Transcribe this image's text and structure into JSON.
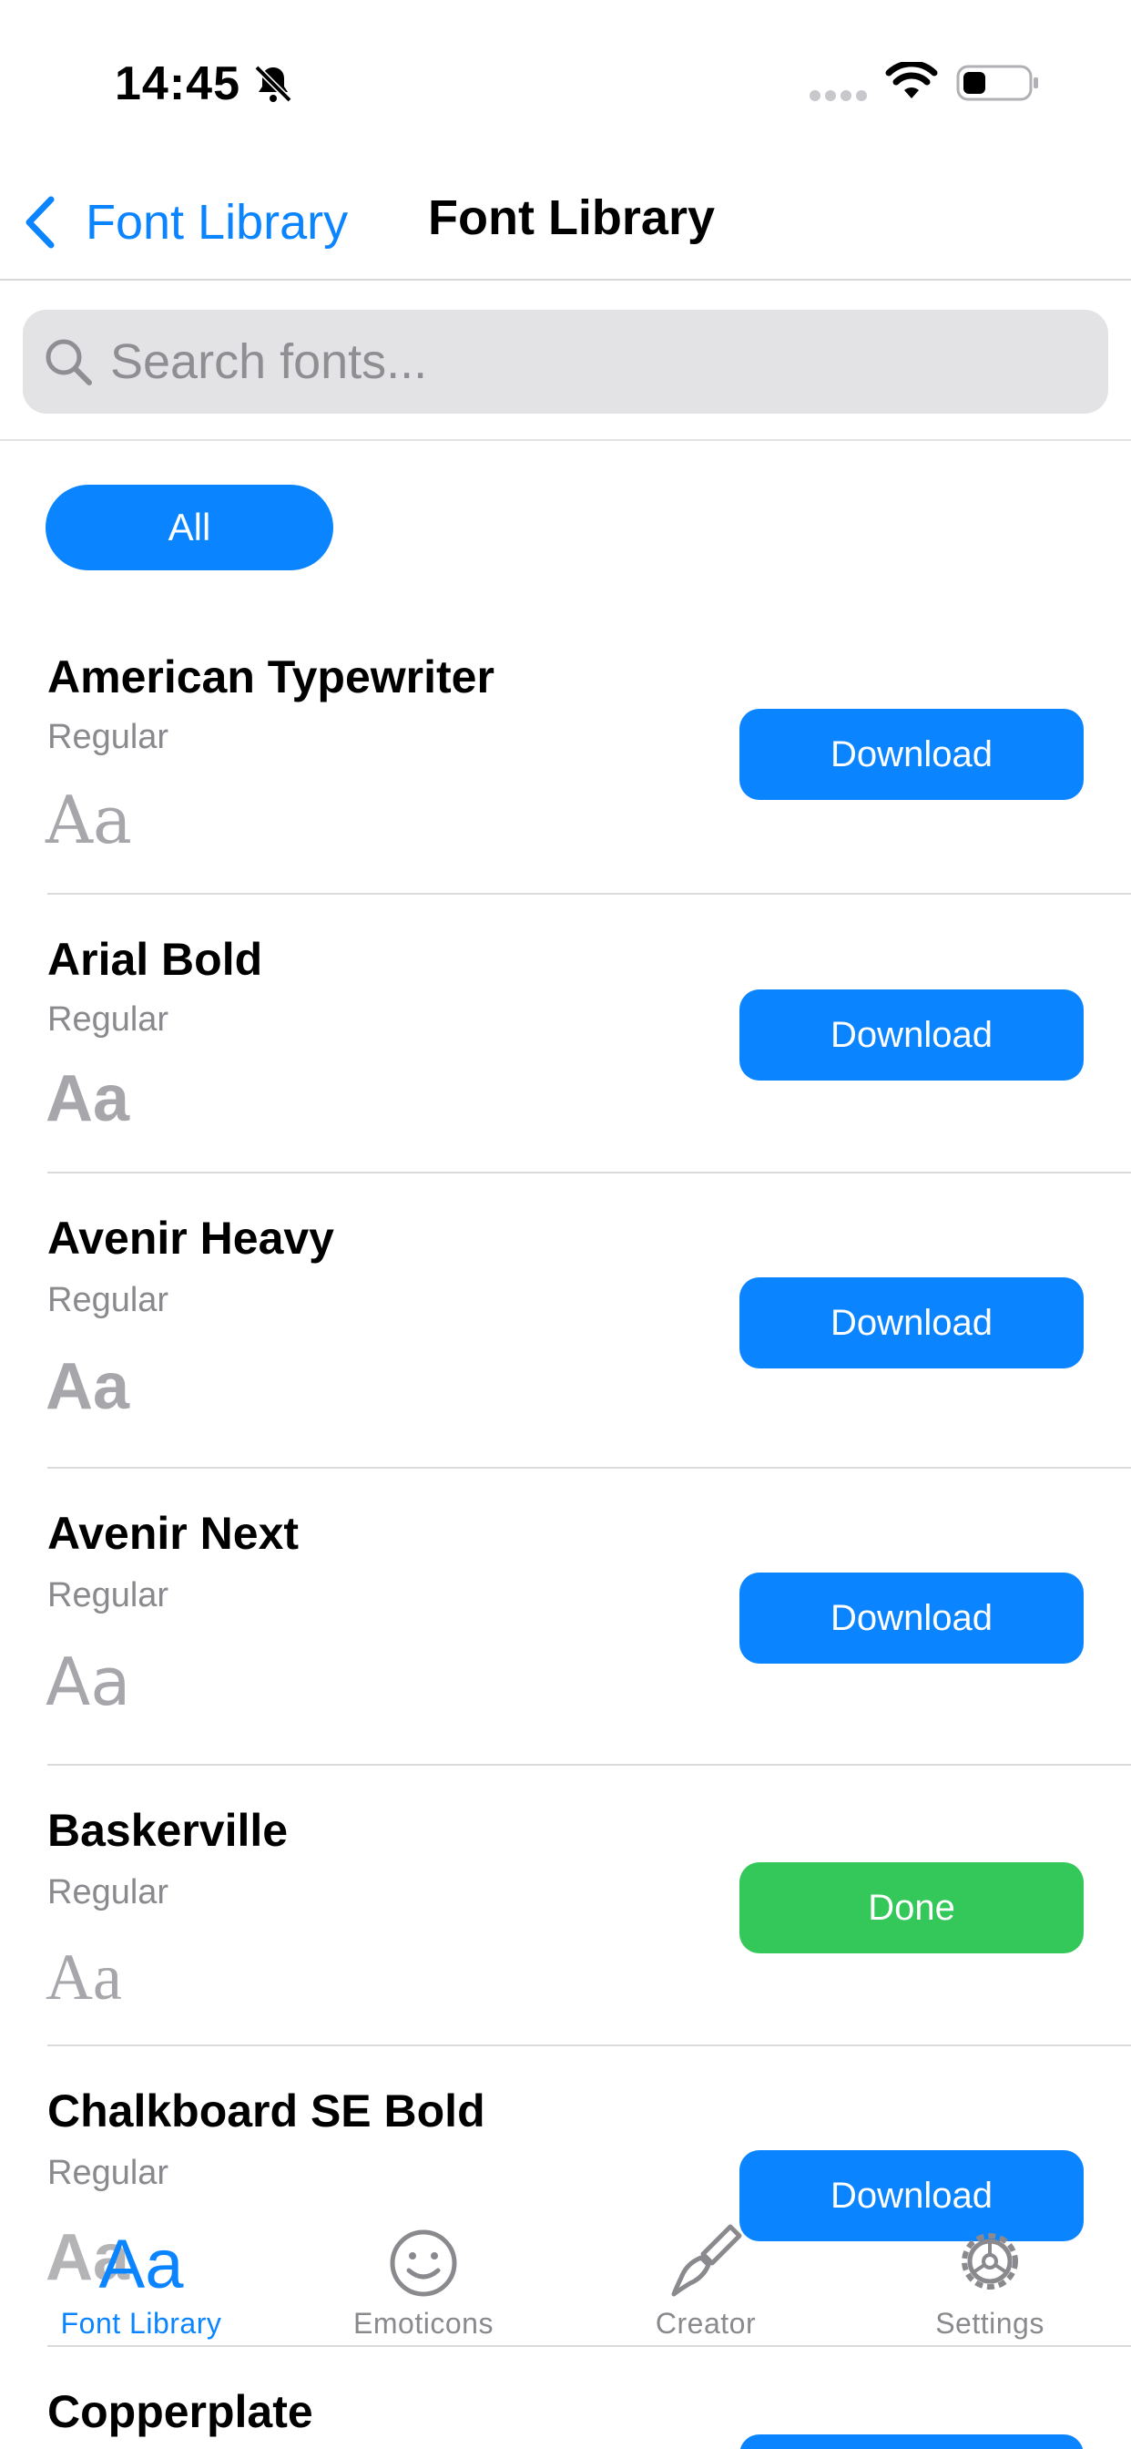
{
  "status_bar": {
    "time": "14:45"
  },
  "nav": {
    "back_label": "Font Library",
    "title": "Font Library"
  },
  "search": {
    "placeholder": "Search fonts..."
  },
  "filter": {
    "selected": "All"
  },
  "fonts": [
    {
      "name": "American Typewriter",
      "style": "Regular",
      "preview": "Aa",
      "action": "Download"
    },
    {
      "name": "Arial Bold",
      "style": "Regular",
      "preview": "Aa",
      "action": "Download"
    },
    {
      "name": "Avenir Heavy",
      "style": "Regular",
      "preview": "Aa",
      "action": "Download"
    },
    {
      "name": "Avenir Next",
      "style": "Regular",
      "preview": "Aa",
      "action": "Download"
    },
    {
      "name": "Baskerville",
      "style": "Regular",
      "preview": "Aa",
      "action": "Done"
    },
    {
      "name": "Chalkboard SE Bold",
      "style": "Regular",
      "preview": "Aa",
      "action": "Download"
    },
    {
      "name": "Copperplate",
      "style": "",
      "preview": "",
      "action": ""
    }
  ],
  "tab_bar": {
    "items": [
      {
        "label": "Font Library",
        "icon": "aa-icon",
        "active": true,
        "glyph": "Aa"
      },
      {
        "label": "Emoticons",
        "icon": "smiley-icon",
        "active": false
      },
      {
        "label": "Creator",
        "icon": "paintbrush-icon",
        "active": false
      },
      {
        "label": "Settings",
        "icon": "gear-icon",
        "active": false
      }
    ]
  },
  "colors": {
    "accent": "#0a84ff",
    "done": "#34c759",
    "secondary_text": "#8a8a8e",
    "search_bg": "#e3e3e6"
  }
}
